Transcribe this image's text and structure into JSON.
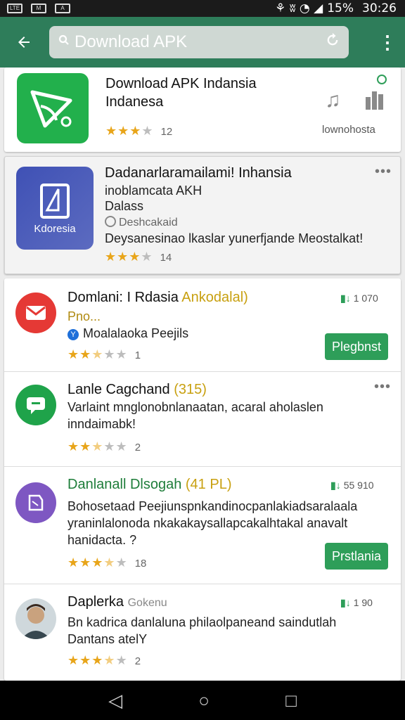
{
  "status_bar": {
    "left": [
      "LTE",
      "M",
      "A"
    ],
    "right_icons": "⚘ ʬ ◔ ◢",
    "battery": "15%",
    "time": "30:26"
  },
  "app_bar": {
    "search_value": "Download APK"
  },
  "featured": {
    "title_line1": "Download APK Indansia",
    "title_line2": "Indanesa",
    "rating": 3,
    "rating_count": "12",
    "source": "lownohosta"
  },
  "promo": {
    "icon_label": "Kdoresia",
    "line1": "Dadanarlaramailami! Inhansia",
    "line2": "inoblamcata AKH",
    "line3": "Dalass",
    "developer": "Deshcakaid",
    "description": "Deysanesinao lkaslar yunerfjande Meostalkat!",
    "rating": 3,
    "rating_count": "14"
  },
  "list": [
    {
      "title": "Domlani: I Rdasia",
      "title_accent": "Ankodalal)",
      "subtitle": "Pno...",
      "developer": "Moalalaoka Peejils",
      "size": "1 070",
      "rating": 2.5,
      "rating_count": "1",
      "button": "Plegbnst",
      "icon_color": "#e53935"
    },
    {
      "title": "Lanle Cagchand",
      "title_accent": "(315)",
      "line1": "Varlaint mnglonobnlanaatan, acaral aholaslen",
      "line2": "inndaimabk!",
      "rating": 2.5,
      "rating_count": "2",
      "icon_color": "#1fa34a"
    },
    {
      "title": "Danlanall Dlsogah",
      "title_accent": "(41 PL)",
      "size": "55 910",
      "line1": "Bohosetaad Peejiunspnkandinocpanlakiadsaralaala",
      "line2": "yraninlalonoda nkakakaysallapcakalhtakal anavalt",
      "line3": "hanidacta. ?",
      "rating": 3.5,
      "rating_count": "18",
      "button": "Prstlania",
      "icon_color": "#7e57c2"
    },
    {
      "title": "Daplerka",
      "title_accent": "Gokenu",
      "size": "1 90",
      "line1": "Bn kadrica danlaluna philaolpaneand saindutlah",
      "line2": "Dantans atelY",
      "rating": 3.5,
      "rating_count": "2"
    }
  ],
  "colors": {
    "app_bar": "#2e7d5a",
    "accent_green": "#2e9e59",
    "star": "#e8a51a"
  }
}
